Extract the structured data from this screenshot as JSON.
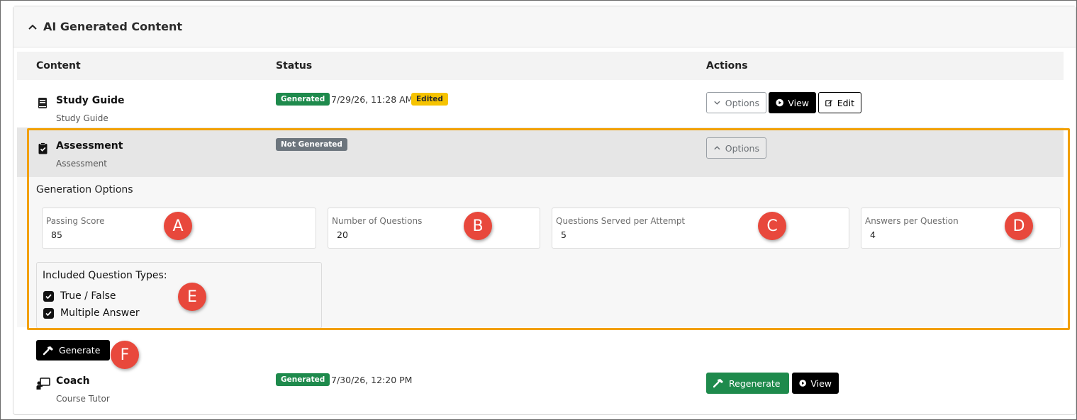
{
  "section": {
    "title": "AI Generated Content",
    "toggle_icon": "chevron-up-icon"
  },
  "table": {
    "headers": {
      "content": "Content",
      "status": "Status",
      "actions": "Actions"
    }
  },
  "rows": {
    "study_guide": {
      "title": "Study Guide",
      "subtitle": "Study Guide",
      "icon": "book-icon",
      "status_badge": "Generated",
      "status_date": "7/29/26, 11:28 AM",
      "edited_badge": "Edited",
      "options_label": "Options",
      "view_label": "View",
      "edit_label": "Edit"
    },
    "assessment": {
      "title": "Assessment",
      "subtitle": "Assessment",
      "icon": "clipboard-check-icon",
      "status_badge": "Not Generated",
      "options_label": "Options"
    },
    "coach": {
      "title": "Coach",
      "subtitle": "Course Tutor",
      "icon": "chalkboard-teacher-icon",
      "status_badge": "Generated",
      "status_date": "7/30/26, 12:20 PM",
      "regenerate_label": "Regenerate",
      "view_label": "View"
    }
  },
  "generation_options": {
    "heading": "Generation Options",
    "passing_score": {
      "label": "Passing Score",
      "value": "85"
    },
    "number_of_questions": {
      "label": "Number of Questions",
      "value": "20"
    },
    "questions_served": {
      "label": "Questions Served per Attempt",
      "value": "5"
    },
    "answers_per_question": {
      "label": "Answers per Question",
      "value": "4"
    },
    "question_types": {
      "title": "Included Question Types:",
      "items": [
        {
          "label": "True / False",
          "checked": true
        },
        {
          "label": "Multiple Answer",
          "checked": true
        }
      ]
    },
    "generate_label": "Generate"
  },
  "callouts": [
    "A",
    "B",
    "C",
    "D",
    "E",
    "F"
  ],
  "colors": {
    "success": "#1e8a4c",
    "warning": "#f6c300",
    "secondary": "#6c757d",
    "highlight": "#f2a000",
    "callout": "#e8483c"
  }
}
